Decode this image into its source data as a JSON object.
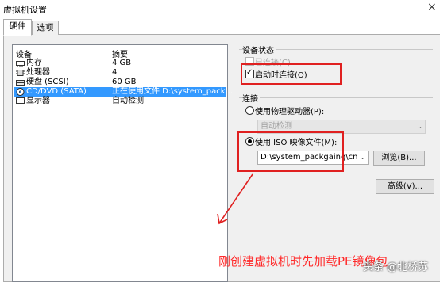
{
  "window": {
    "title": "虚拟机设置",
    "close_glyph": "×"
  },
  "tabs": [
    {
      "label": "硬件"
    },
    {
      "label": "选项"
    }
  ],
  "device_table": {
    "col_device": "设备",
    "col_summary": "摘要",
    "rows": [
      {
        "name": "内存",
        "summary": "4 GB",
        "icon": "memory-icon",
        "selected": false
      },
      {
        "name": "处理器",
        "summary": "4",
        "icon": "processor-icon",
        "selected": false
      },
      {
        "name": "硬盘 (SCSI)",
        "summary": "60 GB",
        "icon": "harddisk-icon",
        "selected": false
      },
      {
        "name": "CD/DVD (SATA)",
        "summary": "正在使用文件 D:\\system_pack...",
        "icon": "cdrom-icon",
        "selected": true
      },
      {
        "name": "显示器",
        "summary": "自动检测",
        "icon": "monitor-icon",
        "selected": false
      }
    ]
  },
  "device_status": {
    "label": "设备状态",
    "connected": {
      "label": "已连接(C)",
      "checked": false,
      "enabled": false
    },
    "connect_at_power_on": {
      "label": "启动时连接(O)",
      "checked": true,
      "enabled": true
    }
  },
  "connection": {
    "label": "连接",
    "physical": {
      "label": "使用物理驱动器(P):",
      "selected": false
    },
    "physical_drive_value": "自动检测",
    "iso": {
      "label": "使用 ISO 映像文件(M):",
      "selected": true
    },
    "iso_path": "D:\\system_packgaing\\cn_wi",
    "browse_label": "浏览(B)..."
  },
  "advanced_label": "高级(V)...",
  "annotation": "刚创建虚拟机时先加载PE镜像包",
  "watermark": "头条 @北桥苏",
  "colors": {
    "annotation_red": "#e02020",
    "selection_blue": "#3399ff"
  }
}
